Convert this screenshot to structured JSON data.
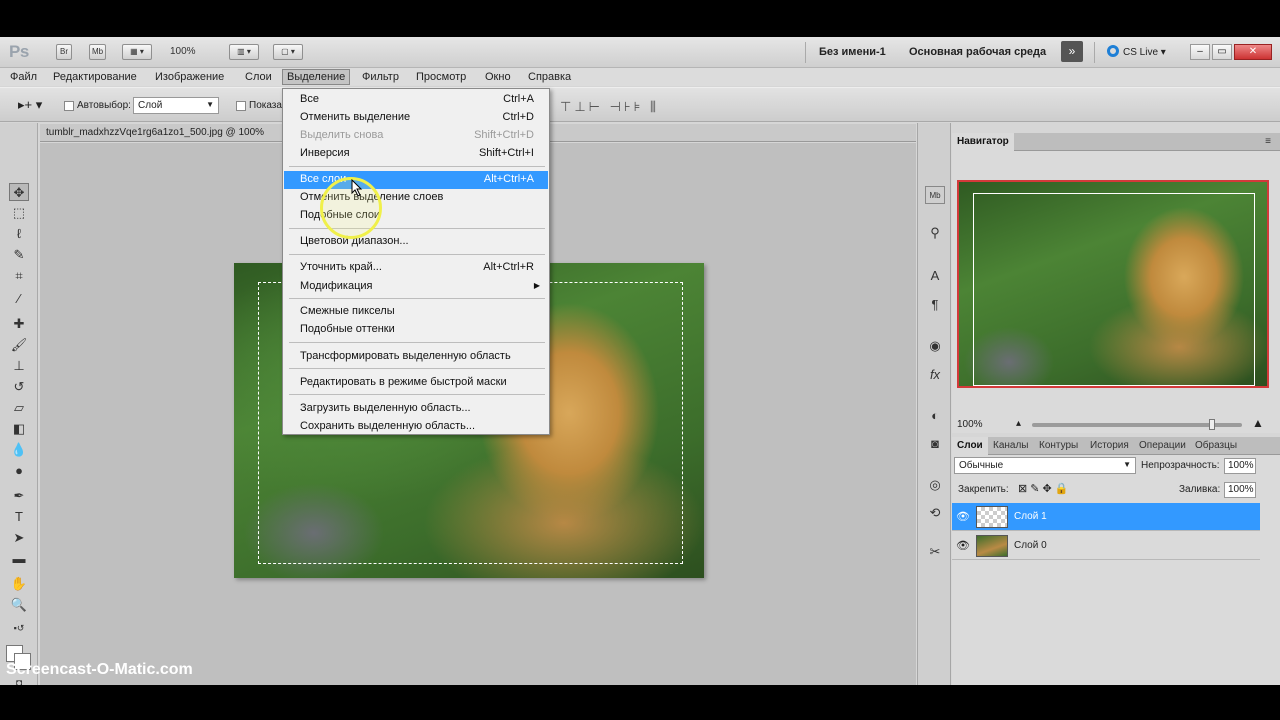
{
  "app": {
    "logo": "Ps",
    "bridge_btn": "Br",
    "minibridge_btn": "Mb",
    "zoom": "100%",
    "doc_title": "Без имени-1",
    "workspace": "Основная рабочая среда",
    "cs_live": "CS Live"
  },
  "menubar": [
    "Файл",
    "Редактирование",
    "Изображение",
    "Слои",
    "Выделение",
    "Фильтр",
    "Просмотр",
    "Окно",
    "Справка"
  ],
  "options": {
    "autoselect_label": "Автовыбор:",
    "autoselect_value": "Слой",
    "show_label": "Показа"
  },
  "document": {
    "tab_title": "tumblr_madxhzzVqe1rg6a1zo1_500.jpg @ 100%"
  },
  "select_menu": {
    "items": [
      {
        "label": "Все",
        "shortcut": "Ctrl+A"
      },
      {
        "label": "Отменить выделение",
        "shortcut": "Ctrl+D"
      },
      {
        "label": "Выделить снова",
        "shortcut": "Shift+Ctrl+D"
      },
      {
        "label": "Инверсия",
        "shortcut": "Shift+Ctrl+I"
      },
      {
        "label": "Все слои",
        "shortcut": "Alt+Ctrl+A"
      },
      {
        "label": "Отменить выделение слоев",
        "shortcut": ""
      },
      {
        "label": "Подобные слои",
        "shortcut": ""
      },
      {
        "label": "Цветовой диапазон...",
        "shortcut": ""
      },
      {
        "label": "Уточнить край...",
        "shortcut": "Alt+Ctrl+R"
      },
      {
        "label": "Модификация",
        "shortcut": ""
      },
      {
        "label": "Смежные пикселы",
        "shortcut": ""
      },
      {
        "label": "Подобные оттенки",
        "shortcut": ""
      },
      {
        "label": "Трансформировать выделенную область",
        "shortcut": ""
      },
      {
        "label": "Редактировать в режиме быстрой маски",
        "shortcut": ""
      },
      {
        "label": "Загрузить выделенную область...",
        "shortcut": ""
      },
      {
        "label": "Сохранить выделенную область...",
        "shortcut": ""
      }
    ],
    "highlight_color": "#3399ff"
  },
  "navigator": {
    "tab": "Навигатор",
    "zoom": "100%"
  },
  "layers": {
    "tabs": [
      "Слои",
      "Каналы",
      "Контуры",
      "История",
      "Операции",
      "Образцы"
    ],
    "blend_mode": "Обычные",
    "opacity_label": "Непрозрачность:",
    "opacity": "100%",
    "lock_label": "Закрепить:",
    "fill_label": "Заливка:",
    "fill": "100%",
    "rows": [
      {
        "name": "Слой 1",
        "selected": true
      },
      {
        "name": "Слой 0",
        "selected": false
      }
    ]
  },
  "watermark": "Screencast-O-Matic.com"
}
